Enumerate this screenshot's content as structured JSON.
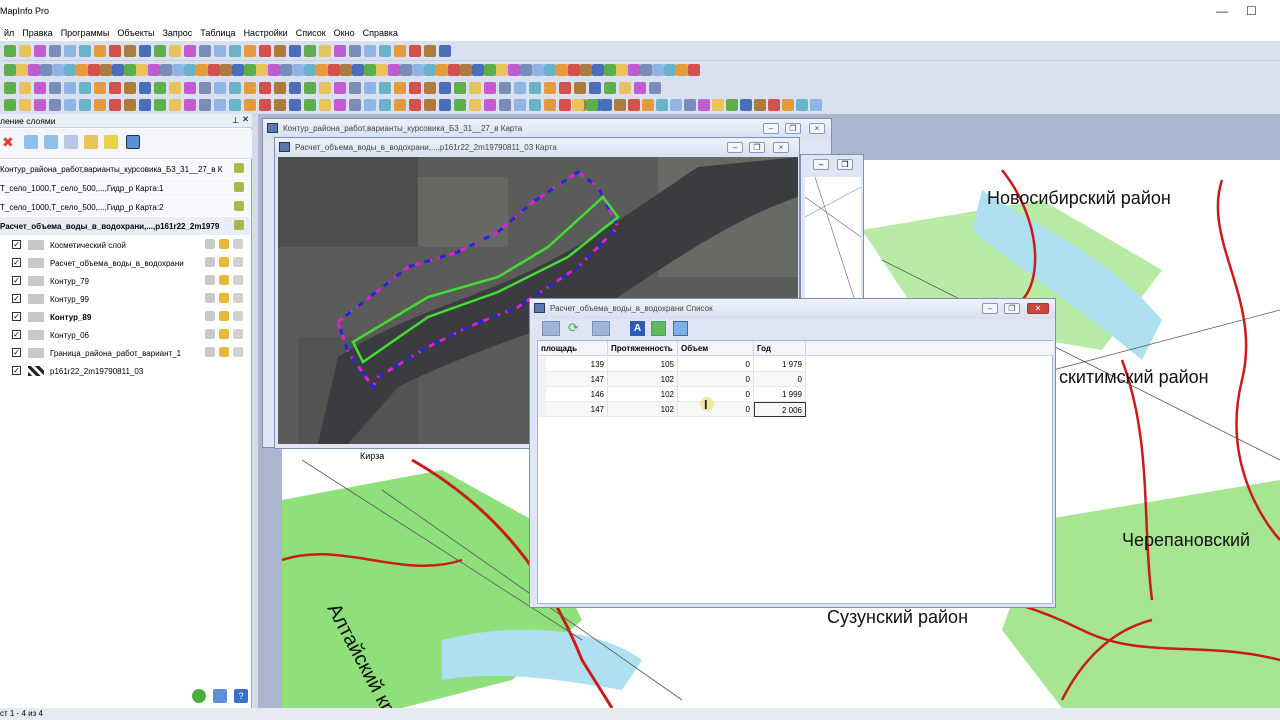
{
  "app": {
    "title": "MapInfo Pro"
  },
  "menu": [
    "йл",
    "Правка",
    "Программы",
    "Объекты",
    "Запрос",
    "Таблица",
    "Настройки",
    "Список",
    "Окно",
    "Справка"
  ],
  "layer_panel": {
    "title": "ление слоями",
    "maps": [
      "Контур_района_работ,варианты_курсовика_Б3_31__27_в К",
      "Т_село_1000,Т_село_500,...,Гидр_р Карта:1",
      "Т_село_1000,Т_село_500,...,Гидр_р Карта:2",
      "Расчет_объема_воды_в_водохрани,...,p161r22_2m1979"
    ],
    "layers": [
      {
        "name": "Косметический слой",
        "checked": true,
        "bold": false
      },
      {
        "name": "Расчет_объема_воды_в_водохрани",
        "checked": true,
        "bold": false
      },
      {
        "name": "Контур_79",
        "checked": true,
        "bold": false
      },
      {
        "name": "Контур_99",
        "checked": true,
        "bold": false
      },
      {
        "name": "Контур_89",
        "checked": true,
        "bold": true
      },
      {
        "name": "Контур_06",
        "checked": true,
        "bold": false
      },
      {
        "name": "Граница_района_работ_вариант_1",
        "checked": true,
        "bold": false
      },
      {
        "name": "p161r22_2m19790811_03",
        "checked": true,
        "bold": false
      }
    ]
  },
  "windows": {
    "map_back": {
      "title": "Контур_района_работ,варианты_курсовика_Б3_31__27_в Карта"
    },
    "map_front": {
      "title": "Расчет_объема_воды_в_водохрани,...,p161r22_2m19790811_03 Карта"
    },
    "list": {
      "title": "Расчет_объема_воды_в_водохрани Список"
    }
  },
  "table": {
    "columns": [
      "площадь",
      "Протяженность",
      "Объем",
      "Год"
    ],
    "rows": [
      [
        "139",
        "105",
        "0",
        "1 979"
      ],
      [
        "147",
        "102",
        "0",
        "0"
      ],
      [
        "146",
        "102",
        "0",
        "1 999"
      ],
      [
        "147",
        "102",
        "0",
        "2 006"
      ]
    ]
  },
  "map_labels": {
    "novosibirsk": "Новосибирский  район",
    "iskitim": "скитимский район",
    "cherepanovo": "Черепановский",
    "suzun": "Сузунский район",
    "altai": "Алтайский край",
    "kirza": "Кирза"
  },
  "status": {
    "text": "ст 1 - 4 из 4"
  },
  "colors": {
    "accent": "#2a5ab5",
    "map_border": "#cc1a1a",
    "forest": "#7fdc6a",
    "water": "#aee0f0"
  }
}
